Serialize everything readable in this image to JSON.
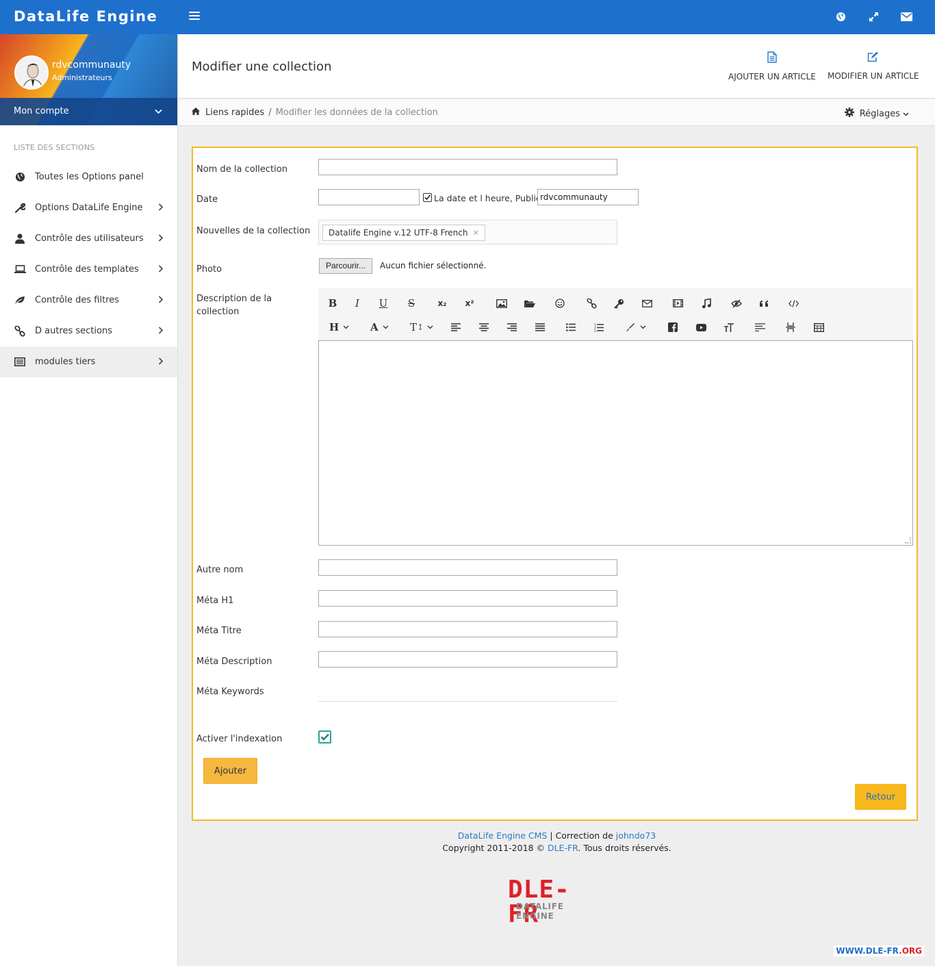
{
  "app": {
    "brand": "DataLife Engine"
  },
  "colors": {
    "primary": "#1e70cd",
    "accent": "#f6b824",
    "link": "#2a7ac7"
  },
  "navbar": {
    "icons": [
      "globe-icon",
      "expand-icon",
      "envelope-icon"
    ]
  },
  "sidebar": {
    "user": {
      "name": "rdvcommunauty",
      "role": "Administrateurs"
    },
    "account_label": "Mon compte",
    "section_title": "LISTE DES SECTIONS",
    "items": [
      {
        "label": "Toutes les Options panel",
        "icon": "globe-icon"
      },
      {
        "label": "Options DataLife Engine",
        "icon": "wrench-icon"
      },
      {
        "label": "Contrôle des utilisateurs",
        "icon": "user-icon"
      },
      {
        "label": "Contrôle des templates",
        "icon": "laptop-icon"
      },
      {
        "label": "Contrôle des filtres",
        "icon": "leaf-icon"
      },
      {
        "label": "D autres sections",
        "icon": "link-icon"
      },
      {
        "label": "modules tiers",
        "icon": "list-icon"
      }
    ]
  },
  "header": {
    "title": "Modifier une collection",
    "add_article": "AJOUTER UN ARTICLE",
    "edit_article": "MODIFIER UN ARTICLE"
  },
  "breadcrumb": {
    "home": "Liens rapides",
    "separator": "/",
    "current": "Modifier les données de la collection",
    "settings": "Réglages"
  },
  "form": {
    "name_label": "Nom de la collection",
    "name_value": "",
    "date_label": "Date",
    "date_value": "",
    "date_check_label": "La date et l heure, Publié:",
    "author_value": "rdvcommunauty",
    "news_label": "Nouvelles de la collection",
    "news_tag": "Datalife Engine v.12 UTF-8 French",
    "news_tag_remove": "×",
    "photo_label": "Photo",
    "file_button": "Parcourir...",
    "file_status": "Aucun fichier sélectionné.",
    "desc_label": "Description de la collection",
    "other_name_label": "Autre nom",
    "meta_h1_label": "Méta H1",
    "meta_title_label": "Méta Titre",
    "meta_desc_label": "Méta Description",
    "meta_keywords_label": "Méta Keywords",
    "index_label": "Activer l'indexation",
    "index_checked": true,
    "submit": "Ajouter",
    "back": "Retour"
  },
  "toolbar": {
    "row1": [
      "B",
      "I",
      "U",
      "S",
      "x₂",
      "x²"
    ],
    "heading": "H",
    "font": "A",
    "size": "T"
  },
  "footer": {
    "cms_link": "DataLife Engine CMS",
    "pipe": " | Correction de ",
    "author_link": "johndo73",
    "copyright": "Copyright 2011-2018 © ",
    "site_link": "DLE-FR",
    "rights": ". Tous droits réservés.",
    "logo_big": "DLE-FR",
    "logo_small": "DATALIFE ENGINE",
    "watermark_a": "WWW.DLE-FR",
    "watermark_b": ".ORG"
  }
}
